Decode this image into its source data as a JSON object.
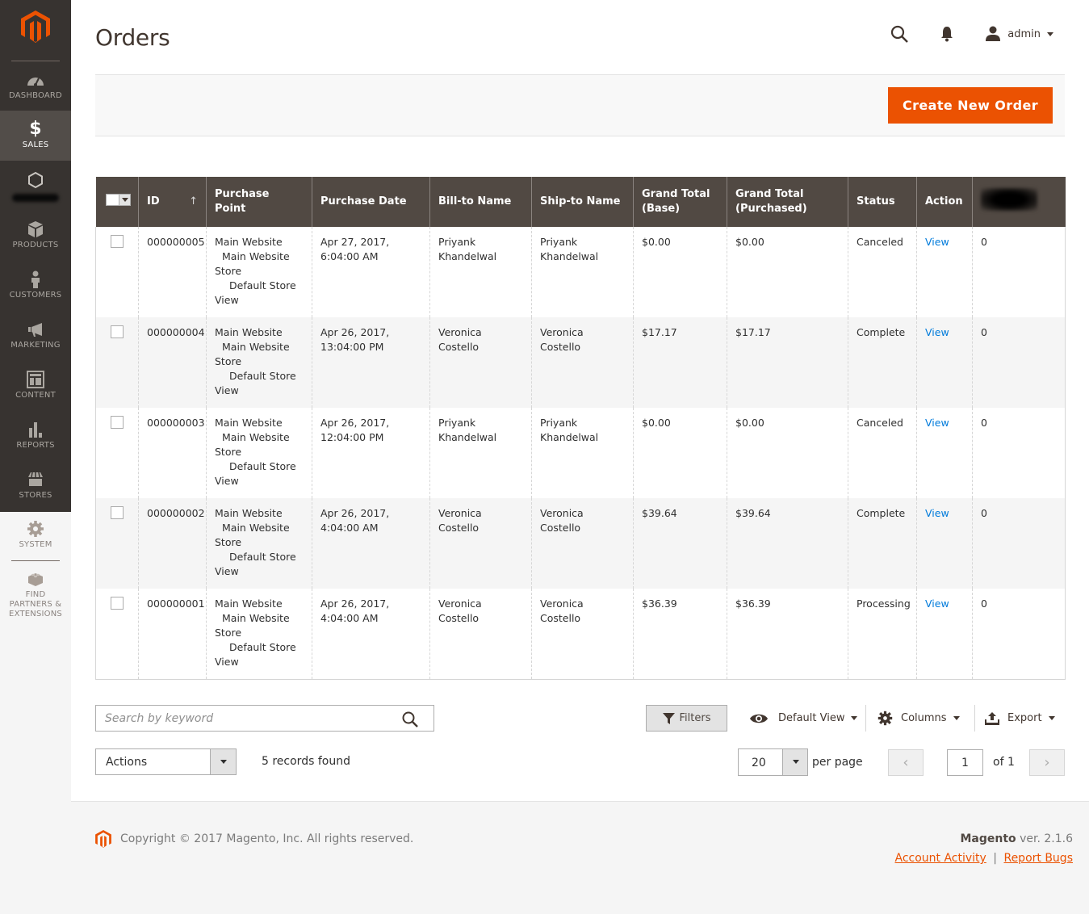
{
  "sidebar": {
    "items": [
      {
        "label": "DASHBOARD",
        "icon": "dashboard-icon",
        "active": false
      },
      {
        "label": "SALES",
        "icon": "dollar-icon",
        "active": true
      },
      {
        "label": "",
        "icon": "hexagon-icon",
        "active": false,
        "redacted": true
      },
      {
        "label": "PRODUCTS",
        "icon": "box-icon",
        "active": false
      },
      {
        "label": "CUSTOMERS",
        "icon": "person-icon",
        "active": false
      },
      {
        "label": "MARKETING",
        "icon": "megaphone-icon",
        "active": false
      },
      {
        "label": "CONTENT",
        "icon": "layout-icon",
        "active": false
      },
      {
        "label": "REPORTS",
        "icon": "bar-chart-icon",
        "active": false
      },
      {
        "label": "STORES",
        "icon": "storefront-icon",
        "active": false
      },
      {
        "label": "SYSTEM",
        "icon": "gear-icon",
        "active": false
      },
      {
        "label": "FIND PARTNERS & EXTENSIONS",
        "icon": "lego-brick-icon",
        "active": false
      }
    ]
  },
  "header": {
    "title": "Orders",
    "user": "admin"
  },
  "action_bar": {
    "create_label": "Create New Order"
  },
  "grid": {
    "columns": [
      "ID",
      "Purchase Point",
      "Purchase Date",
      "Bill-to Name",
      "Ship-to Name",
      "Grand Total (Base)",
      "Grand Total (Purchased)",
      "Status",
      "Action",
      "[redacted]"
    ],
    "sort_indicator": "↑",
    "rows": [
      {
        "id": "000000005",
        "pp": [
          "Main Website",
          "Main Website",
          "Store",
          "Default Store",
          "View"
        ],
        "date": "Apr 27, 2017, 6:04:00 AM",
        "bill": "Priyank Khandelwal",
        "ship": "Priyank Khandelwal",
        "base": "$0.00",
        "purchased": "$0.00",
        "status": "Canceled",
        "action": "View",
        "extra": "0"
      },
      {
        "id": "000000004",
        "pp": [
          "Main Website",
          "Main Website",
          "Store",
          "Default Store",
          "View"
        ],
        "date": "Apr 26, 2017, 13:04:00 PM",
        "bill": "Veronica Costello",
        "ship": "Veronica Costello",
        "base": "$17.17",
        "purchased": "$17.17",
        "status": "Complete",
        "action": "View",
        "extra": "0"
      },
      {
        "id": "000000003",
        "pp": [
          "Main Website",
          "Main Website",
          "Store",
          "Default Store",
          "View"
        ],
        "date": "Apr 26, 2017, 12:04:00 PM",
        "bill": "Priyank Khandelwal",
        "ship": "Priyank Khandelwal",
        "base": "$0.00",
        "purchased": "$0.00",
        "status": "Canceled",
        "action": "View",
        "extra": "0"
      },
      {
        "id": "000000002",
        "pp": [
          "Main Website",
          "Main Website",
          "Store",
          "Default Store",
          "View"
        ],
        "date": "Apr 26, 2017, 4:04:00 AM",
        "bill": "Veronica Costello",
        "ship": "Veronica Costello",
        "base": "$39.64",
        "purchased": "$39.64",
        "status": "Complete",
        "action": "View",
        "extra": "0"
      },
      {
        "id": "000000001",
        "pp": [
          "Main Website",
          "Main Website",
          "Store",
          "Default Store",
          "View"
        ],
        "date": "Apr 26, 2017, 4:04:00 AM",
        "bill": "Veronica Costello",
        "ship": "Veronica Costello",
        "base": "$36.39",
        "purchased": "$36.39",
        "status": "Processing",
        "action": "View",
        "extra": "0"
      }
    ]
  },
  "toolbar": {
    "search_placeholder": "Search by keyword",
    "filters_label": "Filters",
    "view_label": "Default View",
    "columns_label": "Columns",
    "export_label": "Export",
    "actions_label": "Actions",
    "records_found": "5 records found",
    "per_page_value": "20",
    "per_page_label": "per page",
    "page_value": "1",
    "page_of": "of 1"
  },
  "footer": {
    "copyright": "Copyright © 2017 Magento, Inc. All rights reserved.",
    "brand": "Magento",
    "version": " ver. 2.1.6",
    "account_activity": "Account Activity",
    "separator": "|",
    "report_bugs": "Report Bugs"
  },
  "colors": {
    "accent": "#eb5202",
    "sidebar_bg": "#373330",
    "header_bg": "#514943",
    "link": "#007bdb"
  }
}
